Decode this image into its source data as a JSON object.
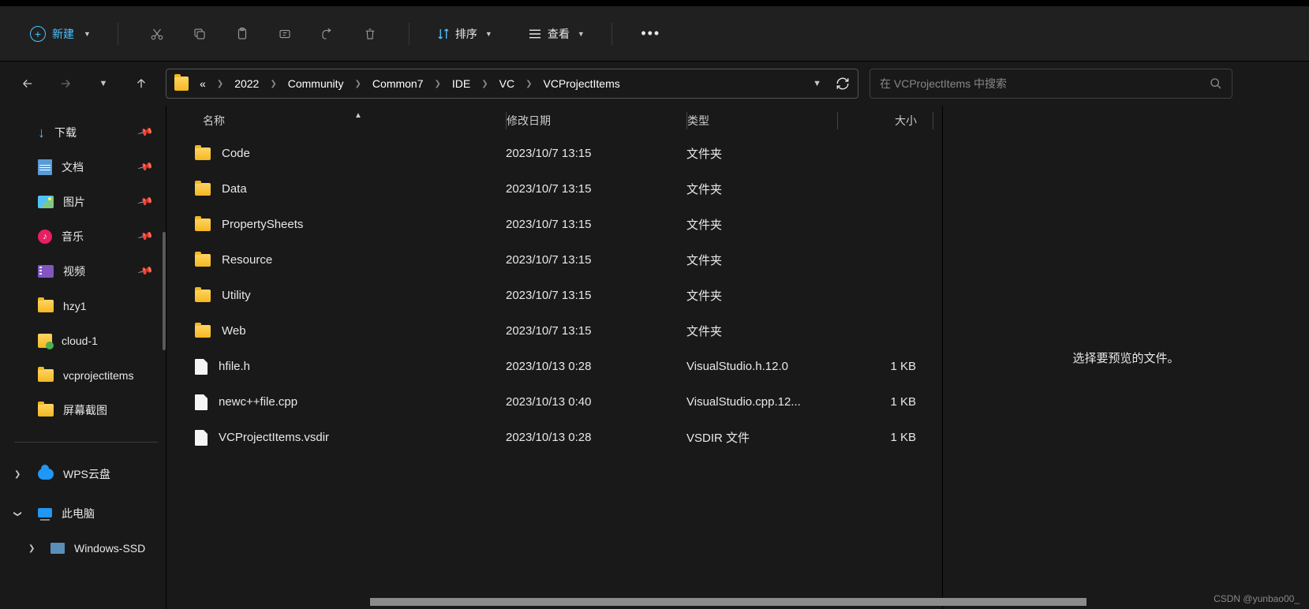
{
  "toolbar": {
    "new_label": "新建",
    "sort_label": "排序",
    "view_label": "查看"
  },
  "breadcrumb": {
    "ellipsis": "«",
    "items": [
      "2022",
      "Community",
      "Common7",
      "IDE",
      "VC",
      "VCProjectItems"
    ]
  },
  "search": {
    "placeholder": "在 VCProjectItems 中搜索"
  },
  "columns": {
    "name": "名称",
    "date": "修改日期",
    "type": "类型",
    "size": "大小"
  },
  "sidebar": {
    "items": [
      {
        "icon": "download",
        "label": "下载",
        "pin": true
      },
      {
        "icon": "doc",
        "label": "文档",
        "pin": true
      },
      {
        "icon": "img",
        "label": "图片",
        "pin": true
      },
      {
        "icon": "music",
        "label": "音乐",
        "pin": true
      },
      {
        "icon": "video",
        "label": "视频",
        "pin": true
      },
      {
        "icon": "folder",
        "label": "hzy1",
        "pin": false
      },
      {
        "icon": "shield",
        "label": "cloud-1",
        "pin": false
      },
      {
        "icon": "folder",
        "label": "vcprojectitems",
        "pin": false
      },
      {
        "icon": "folder",
        "label": "屏幕截图",
        "pin": false
      }
    ],
    "wps": "WPS云盘",
    "pc": "此电脑",
    "drive": "Windows-SSD"
  },
  "files": [
    {
      "icon": "folder",
      "name": "Code",
      "date": "2023/10/7 13:15",
      "type": "文件夹",
      "size": ""
    },
    {
      "icon": "folder",
      "name": "Data",
      "date": "2023/10/7 13:15",
      "type": "文件夹",
      "size": ""
    },
    {
      "icon": "folder",
      "name": "PropertySheets",
      "date": "2023/10/7 13:15",
      "type": "文件夹",
      "size": ""
    },
    {
      "icon": "folder",
      "name": "Resource",
      "date": "2023/10/7 13:15",
      "type": "文件夹",
      "size": ""
    },
    {
      "icon": "folder",
      "name": "Utility",
      "date": "2023/10/7 13:15",
      "type": "文件夹",
      "size": ""
    },
    {
      "icon": "folder",
      "name": "Web",
      "date": "2023/10/7 13:15",
      "type": "文件夹",
      "size": ""
    },
    {
      "icon": "file",
      "name": "hfile.h",
      "date": "2023/10/13 0:28",
      "type": "VisualStudio.h.12.0",
      "size": "1 KB"
    },
    {
      "icon": "file",
      "name": "newc++file.cpp",
      "date": "2023/10/13 0:40",
      "type": "VisualStudio.cpp.12...",
      "size": "1 KB"
    },
    {
      "icon": "file",
      "name": "VCProjectItems.vsdir",
      "date": "2023/10/13 0:28",
      "type": "VSDIR 文件",
      "size": "1 KB"
    }
  ],
  "preview": {
    "empty": "选择要预览的文件。"
  },
  "watermark": "CSDN @yunbao00_"
}
